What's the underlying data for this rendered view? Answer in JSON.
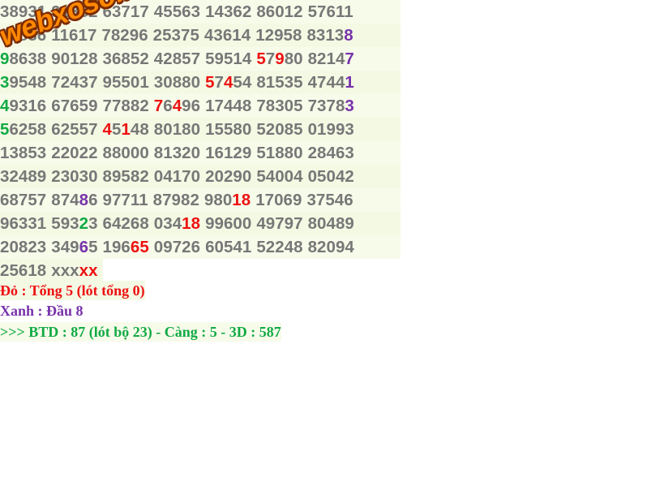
{
  "colors": {
    "gray": "#777777",
    "red": "#ee1111",
    "green": "#11aa44",
    "purple": "#7733aa",
    "watermark": "#ff8800"
  },
  "watermark": "webxoso.net",
  "rows": [
    [
      [
        [
          "38931",
          "gray"
        ]
      ],
      [
        [
          "91382",
          "gray"
        ]
      ],
      [
        [
          "63717",
          "gray"
        ]
      ],
      [
        [
          "45563",
          "gray"
        ]
      ],
      [
        [
          "14362",
          "gray"
        ]
      ],
      [
        [
          "86012",
          "gray"
        ]
      ],
      [
        [
          "57611",
          "gray"
        ]
      ]
    ],
    [
      [
        [
          "02836",
          "gray"
        ]
      ],
      [
        [
          "11617",
          "gray"
        ]
      ],
      [
        [
          "78296",
          "gray"
        ]
      ],
      [
        [
          "25375",
          "gray"
        ]
      ],
      [
        [
          "43614",
          "gray"
        ]
      ],
      [
        [
          "12958",
          "gray"
        ]
      ],
      [
        [
          "8313",
          "gray"
        ],
        [
          "8",
          "purple"
        ]
      ]
    ],
    [
      [
        [
          "9",
          "green"
        ],
        [
          "8638",
          "gray"
        ]
      ],
      [
        [
          "90128",
          "gray"
        ]
      ],
      [
        [
          "36852",
          "gray"
        ]
      ],
      [
        [
          "42857",
          "gray"
        ]
      ],
      [
        [
          "59514",
          "gray"
        ]
      ],
      [
        [
          "5",
          "red"
        ],
        [
          "7",
          "gray"
        ],
        [
          "9",
          "red"
        ],
        [
          "80",
          "gray"
        ]
      ],
      [
        [
          "8214",
          "gray"
        ],
        [
          "7",
          "purple"
        ]
      ]
    ],
    [
      [
        [
          "3",
          "green"
        ],
        [
          "9548",
          "gray"
        ]
      ],
      [
        [
          "72437",
          "gray"
        ]
      ],
      [
        [
          "95501",
          "gray"
        ]
      ],
      [
        [
          "30880",
          "gray"
        ]
      ],
      [
        [
          "5",
          "red"
        ],
        [
          "7",
          "gray"
        ],
        [
          "4",
          "red"
        ],
        [
          "54",
          "gray"
        ]
      ],
      [
        [
          "81535",
          "gray"
        ]
      ],
      [
        [
          "4744",
          "gray"
        ],
        [
          "1",
          "purple"
        ]
      ]
    ],
    [
      [
        [
          "4",
          "green"
        ],
        [
          "9316",
          "gray"
        ]
      ],
      [
        [
          "67659",
          "gray"
        ]
      ],
      [
        [
          "77882",
          "gray"
        ]
      ],
      [
        [
          "7",
          "red"
        ],
        [
          "6",
          "gray"
        ],
        [
          "4",
          "red"
        ],
        [
          "96",
          "gray"
        ]
      ],
      [
        [
          "17448",
          "gray"
        ]
      ],
      [
        [
          "78305",
          "gray"
        ]
      ],
      [
        [
          "7378",
          "gray"
        ],
        [
          "3",
          "purple"
        ]
      ]
    ],
    [
      [
        [
          "5",
          "green"
        ],
        [
          "6258",
          "gray"
        ]
      ],
      [
        [
          "62557",
          "gray"
        ]
      ],
      [
        [
          "4",
          "red"
        ],
        [
          "5",
          "gray"
        ],
        [
          "1",
          "red"
        ],
        [
          "48",
          "gray"
        ]
      ],
      [
        [
          "80180",
          "gray"
        ]
      ],
      [
        [
          "15580",
          "gray"
        ]
      ],
      [
        [
          "52085",
          "gray"
        ]
      ],
      [
        [
          "01993",
          "gray"
        ]
      ]
    ],
    [
      [
        [
          "13853",
          "gray"
        ]
      ],
      [
        [
          "22022",
          "gray"
        ]
      ],
      [
        [
          "88000",
          "gray"
        ]
      ],
      [
        [
          "81320",
          "gray"
        ]
      ],
      [
        [
          "16129",
          "gray"
        ]
      ],
      [
        [
          "51880",
          "gray"
        ]
      ],
      [
        [
          "28463",
          "gray"
        ]
      ]
    ],
    [
      [
        [
          "32489",
          "gray"
        ]
      ],
      [
        [
          "23030",
          "gray"
        ]
      ],
      [
        [
          "89582",
          "gray"
        ]
      ],
      [
        [
          "04170",
          "gray"
        ]
      ],
      [
        [
          "20290",
          "gray"
        ]
      ],
      [
        [
          "54004",
          "gray"
        ]
      ],
      [
        [
          "05042",
          "gray"
        ]
      ]
    ],
    [
      [
        [
          "68757",
          "gray"
        ]
      ],
      [
        [
          "874",
          "gray"
        ],
        [
          "8",
          "purple"
        ],
        [
          "6",
          "gray"
        ]
      ],
      [
        [
          "97711",
          "gray"
        ]
      ],
      [
        [
          "87982",
          "gray"
        ]
      ],
      [
        [
          "980",
          "gray"
        ],
        [
          "18",
          "red"
        ]
      ],
      [
        [
          "17069",
          "gray"
        ]
      ],
      [
        [
          "37546",
          "gray"
        ]
      ]
    ],
    [
      [
        [
          "96331",
          "gray"
        ]
      ],
      [
        [
          "593",
          "gray"
        ],
        [
          "2",
          "green"
        ],
        [
          "3",
          "gray"
        ]
      ],
      [
        [
          "64268",
          "gray"
        ]
      ],
      [
        [
          "034",
          "gray"
        ],
        [
          "18",
          "red"
        ]
      ],
      [
        [
          "99600",
          "gray"
        ]
      ],
      [
        [
          "49797",
          "gray"
        ]
      ],
      [
        [
          "80489",
          "gray"
        ]
      ]
    ],
    [
      [
        [
          "20823",
          "gray"
        ]
      ],
      [
        [
          "349",
          "gray"
        ],
        [
          "6",
          "purple"
        ],
        [
          "5",
          "gray"
        ]
      ],
      [
        [
          "196",
          "gray"
        ],
        [
          "65",
          "red"
        ]
      ],
      [
        [
          "09726",
          "gray"
        ]
      ],
      [
        [
          "60541",
          "gray"
        ]
      ],
      [
        [
          "52248",
          "gray"
        ]
      ],
      [
        [
          "82094",
          "gray"
        ]
      ]
    ]
  ],
  "last_row": [
    [
      [
        "25618",
        "gray"
      ]
    ],
    [
      [
        "xxx",
        "gray"
      ],
      [
        "xx",
        "red"
      ]
    ]
  ],
  "notes": {
    "red": "Đỏ : Tổng 5 (lót tổng 0)",
    "purple": "Xanh : Đầu 8",
    "green": ">>> BTD : 87 (lót bộ 23) - Càng : 5 - 3D : 587"
  }
}
